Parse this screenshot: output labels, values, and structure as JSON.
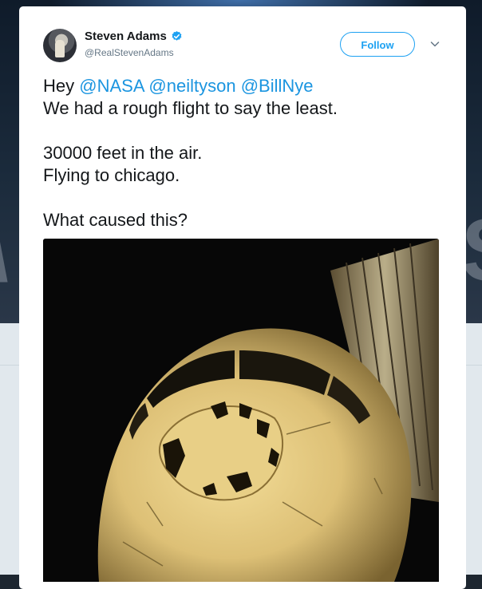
{
  "tweet": {
    "author": {
      "name": "Steven Adams",
      "handle": "@RealStevenAdams",
      "verified": true
    },
    "follow_label": "Follow",
    "text": {
      "line1_prefix": "Hey ",
      "mentions": [
        "@NASA",
        "@neiltyson",
        "@BillNye"
      ],
      "line2": "We had a rough flight to say the least.",
      "line3": "30000 feet in the air.",
      "line4": "Flying to chicago.",
      "line5": "What caused this?"
    },
    "media": {
      "icon": "photo-airplane-nose-damage"
    }
  },
  "colors": {
    "link": "#1b95e0",
    "accent": "#1da1f2",
    "text": "#14171a",
    "secondary": "#657786"
  }
}
